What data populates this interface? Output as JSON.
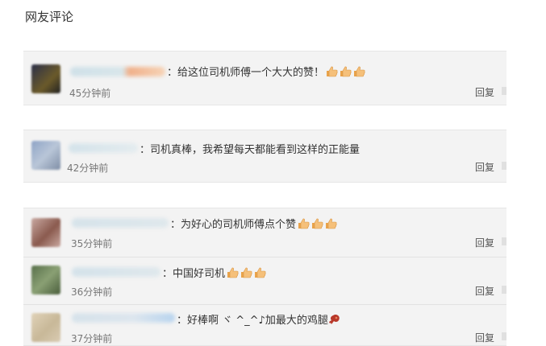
{
  "section_title": "网友评论",
  "reply_label": "回复",
  "comments": [
    {
      "text": "：给这位司机师傅一个大大的赞！",
      "time": "45分钟前",
      "emoji_count": 3
    },
    {
      "text": "：司机真棒，我希望每天都能看到这样的正能量",
      "time": "42分钟前",
      "emoji_count": 0
    },
    {
      "text": "：为好心的司机师傅点个赞",
      "time": "35分钟前",
      "emoji_count": 3
    },
    {
      "text": "：中国好司机",
      "time": "36分钟前",
      "emoji_count": 3
    },
    {
      "text": "：好棒啊 ヾ ^_^♪加最大的鸡腿",
      "time": "37分钟前",
      "emoji_count": 1
    }
  ],
  "icons": {
    "thumb": "thumbs-up-icon",
    "drumstick": "chicken-leg-icon"
  },
  "colors": {
    "card_bg": "#f3f3f3",
    "text": "#333333",
    "time": "#777777",
    "thumb": "#f2b45e"
  }
}
